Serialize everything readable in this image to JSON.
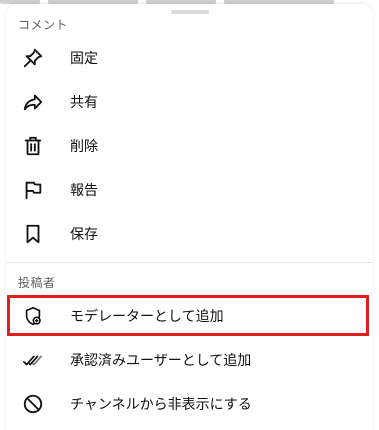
{
  "sections": {
    "comment_title": "コメント",
    "poster_title": "投稿者"
  },
  "comment_items": [
    {
      "label": "固定",
      "icon": "pin-icon"
    },
    {
      "label": "共有",
      "icon": "share-arrow-icon"
    },
    {
      "label": "削除",
      "icon": "trash-icon"
    },
    {
      "label": "報告",
      "icon": "flag-icon"
    },
    {
      "label": "保存",
      "icon": "bookmark-icon"
    }
  ],
  "poster_items": [
    {
      "label": "モデレーターとして追加",
      "icon": "shield-add-icon"
    },
    {
      "label": "承認済みユーザーとして追加",
      "icon": "double-check-icon"
    },
    {
      "label": "チャンネルから非表示にする",
      "icon": "block-icon"
    }
  ],
  "highlight_color": "#e0201c"
}
